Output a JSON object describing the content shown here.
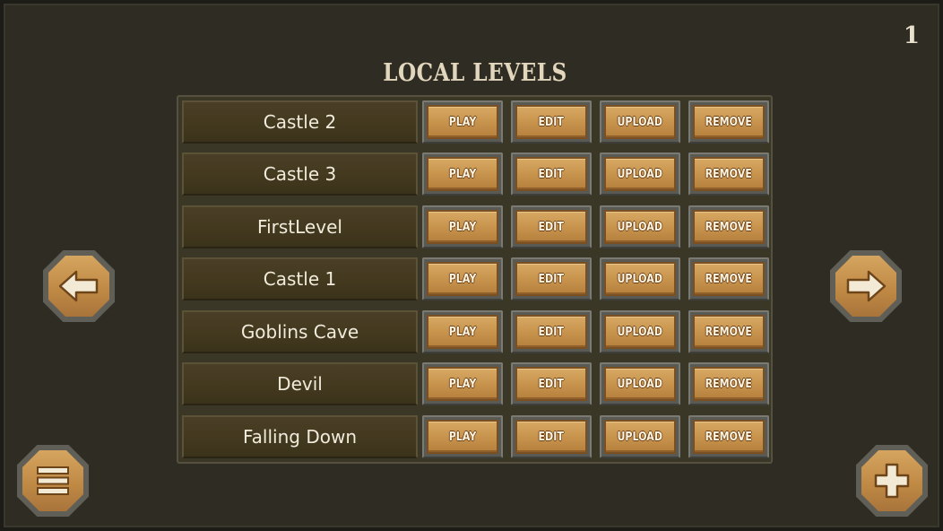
{
  "header": {
    "page_number": "1",
    "title": "LOCAL LEVELS"
  },
  "levels": [
    {
      "name": "Castle 2"
    },
    {
      "name": "Castle 3"
    },
    {
      "name": "FirstLevel"
    },
    {
      "name": "Castle 1"
    },
    {
      "name": "Goblins Cave"
    },
    {
      "name": "Devil"
    },
    {
      "name": "Falling Down"
    }
  ],
  "actions": {
    "play": "PLAY",
    "edit": "EDIT",
    "upload": "UPLOAD",
    "remove": "REMOVE"
  },
  "navigation": {
    "prev_icon": "arrow-left-icon",
    "next_icon": "arrow-right-icon",
    "menu_icon": "menu-icon",
    "add_icon": "plus-icon"
  },
  "colors": {
    "background": "#2f2d23",
    "button_fill": "#c8944d",
    "button_text": "#fff4e0",
    "title_text": "#e2d6bd"
  }
}
